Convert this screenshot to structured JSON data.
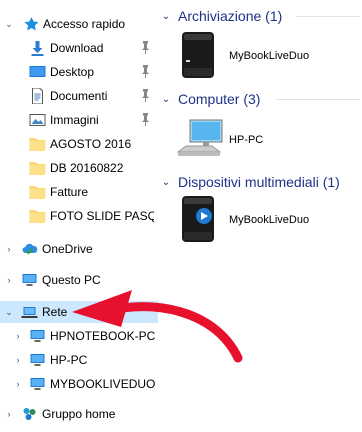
{
  "nav": {
    "quick_access": {
      "label": "Accesso rapido",
      "items": [
        {
          "label": "Download",
          "icon": "download-icon",
          "pinned": true
        },
        {
          "label": "Desktop",
          "icon": "desktop-icon",
          "pinned": true
        },
        {
          "label": "Documenti",
          "icon": "documents-icon",
          "pinned": true
        },
        {
          "label": "Immagini",
          "icon": "pictures-icon",
          "pinned": true
        },
        {
          "label": "AGOSTO 2016",
          "icon": "folder-icon",
          "pinned": false
        },
        {
          "label": "DB 20160822",
          "icon": "folder-icon",
          "pinned": false
        },
        {
          "label": "Fatture",
          "icon": "folder-icon",
          "pinned": false
        },
        {
          "label": "FOTO SLIDE PASQUA",
          "icon": "folder-icon",
          "pinned": false
        }
      ]
    },
    "onedrive_label": "OneDrive",
    "this_pc_label": "Questo PC",
    "network": {
      "label": "Rete",
      "children": [
        "HPNOTEBOOK-PC",
        "HP-PC",
        "MYBOOKLIVEDUO"
      ]
    },
    "homegroup_label": "Gruppo home"
  },
  "groups": [
    {
      "title": "Archiviazione (1)",
      "items": [
        {
          "label": "MyBookLiveDuo",
          "icon": "nas-drive-icon"
        }
      ]
    },
    {
      "title": "Computer (3)",
      "items": [
        {
          "label": "HP-PC",
          "icon": "computer-icon"
        }
      ]
    },
    {
      "title": "Dispositivi multimediali (1)",
      "items": [
        {
          "label": "MyBookLiveDuo",
          "icon": "media-device-icon"
        }
      ]
    }
  ],
  "colors": {
    "selection": "#cce8ff",
    "group_title": "#1e3287",
    "arrow": "#e8112d"
  }
}
